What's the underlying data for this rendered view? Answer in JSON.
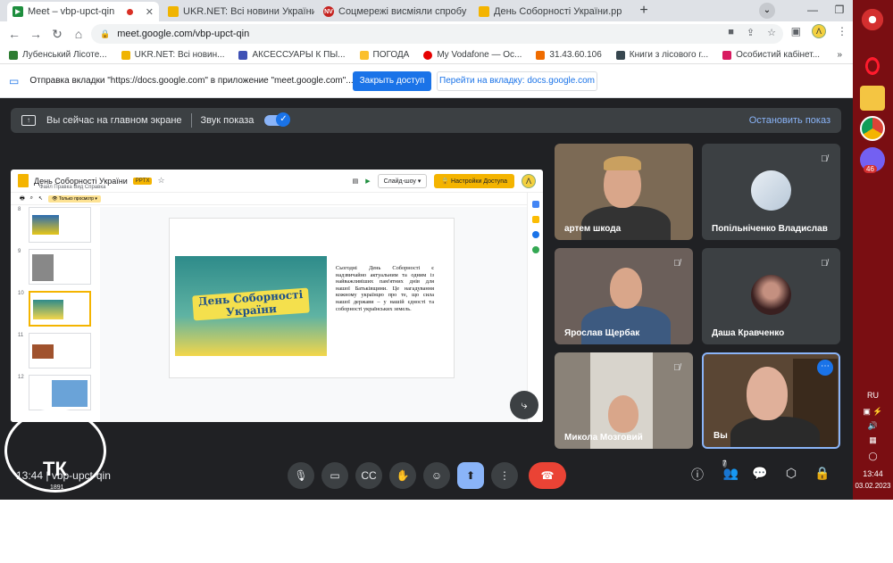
{
  "browser": {
    "tabs": [
      {
        "title": "Meet – vbp-upct-qin",
        "color": "#1e8e3e",
        "active": true
      },
      {
        "title": "UKR.NET: Всі новини України, ос",
        "color": "#f0b400"
      },
      {
        "title": "Соцмережі висміяли спробу РФ",
        "color": "#c5221f"
      },
      {
        "title": "День Соборності України.pp",
        "color": "#f4b400"
      }
    ],
    "url": "meet.google.com/vbp-upct-qin",
    "bookmarks": [
      {
        "label": "Лубенський Лісоте...",
        "color": "#2e7d32"
      },
      {
        "label": "UKR.NET: Всі новин...",
        "color": "#f0b400"
      },
      {
        "label": "АКСЕССУАРЫ К ПЫ...",
        "color": "#3f51b5"
      },
      {
        "label": "ПОГОДА",
        "color": "#fbc02d"
      },
      {
        "label": "My Vodafone — Ос...",
        "color": "#e60000"
      },
      {
        "label": "31.43.60.106",
        "color": "#ef6c00"
      },
      {
        "label": "Книги з лісового г...",
        "color": "#37474f"
      },
      {
        "label": "Особистий кабінет...",
        "color": "#d81b60"
      }
    ],
    "infobar": {
      "text": "Отправка вкладки \"https://docs.google.com\" в приложение \"meet.google.com\"...",
      "primary": "Закрыть доступ",
      "secondary": "Перейти на вкладку: docs.google.com"
    }
  },
  "meet": {
    "presbar": {
      "status": "Вы сейчас на главном экране",
      "sound": "Звук показа",
      "stop": "Остановить показ"
    },
    "slides_app": {
      "title": "День Соборності України",
      "badge": "PPTX",
      "menu": "Файл   Правка   Вид   Справка",
      "slideshow": "Слайд-шоу",
      "access": "Настройки Доступа",
      "mode": "Только просмотр",
      "thumb_numbers": [
        "8",
        "9",
        "10",
        "11",
        "12"
      ],
      "slide_banner": "День Соборності України",
      "slide_text": "Сьогодні День Соборності є надзвичайно актуальним та одним із найважливіших пам'ятних днів для нашої Батьківщини. Це нагадування кожному українцю про те, що сила нашої держави – у нашій єдності та соборності українських земель."
    },
    "participants": [
      {
        "name": "артем шкода"
      },
      {
        "name": "Попільніченко Владислав"
      },
      {
        "name": "Ярослав Щербак"
      },
      {
        "name": "Даша Кравченко"
      },
      {
        "name": "Микола Мозговий"
      },
      {
        "name": "Вы"
      }
    ],
    "clock": "13:44",
    "meeting_code": "vbp-upct-qin",
    "participant_count": "7"
  },
  "taskbar": {
    "lang": "RU",
    "time": "13:44",
    "date": "03.02.2023",
    "viber_badge": "46"
  },
  "watermark": {
    "letters": "ТК",
    "year": "1891"
  }
}
